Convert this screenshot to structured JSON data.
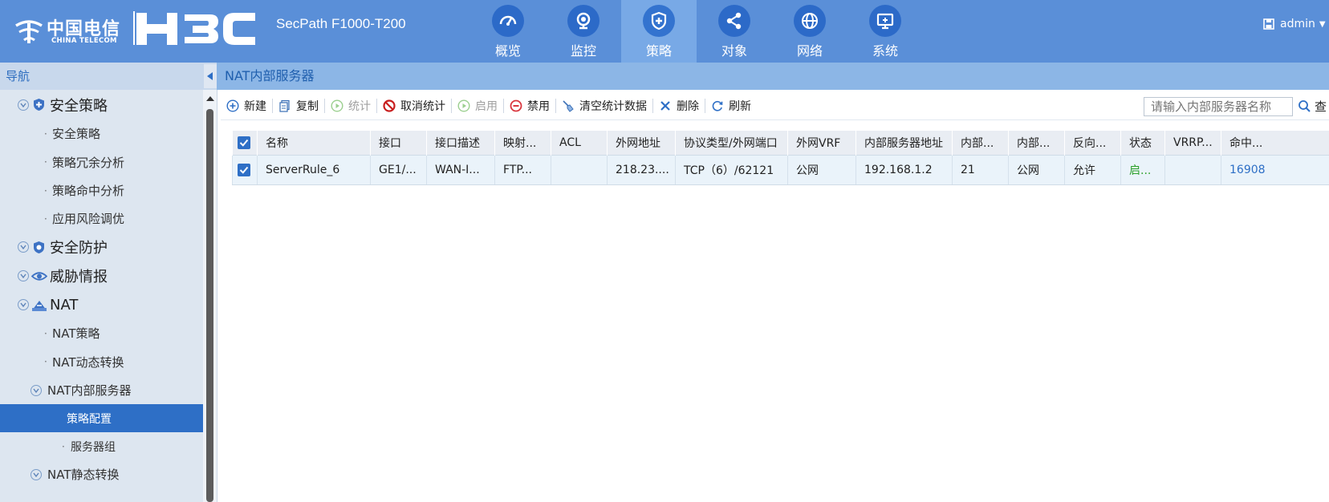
{
  "header": {
    "brand_cn": "中国电信",
    "brand_en": "CHINA TELECOM",
    "h3c_logo": "H3C",
    "product": "SecPath F1000-T200",
    "user": "admin",
    "nav": [
      {
        "label": "概览",
        "icon": "dashboard-icon"
      },
      {
        "label": "监控",
        "icon": "camera-icon"
      },
      {
        "label": "策略",
        "icon": "shield-icon",
        "active": true
      },
      {
        "label": "对象",
        "icon": "share-icon"
      },
      {
        "label": "网络",
        "icon": "globe-icon"
      },
      {
        "label": "系统",
        "icon": "monitor-icon"
      }
    ]
  },
  "sidebar": {
    "title": "导航",
    "items": [
      {
        "label": "安全策略"
      },
      {
        "label": "安全策略"
      },
      {
        "label": "策略冗余分析"
      },
      {
        "label": "策略命中分析"
      },
      {
        "label": "应用风险调优"
      },
      {
        "label": "安全防护"
      },
      {
        "label": "威胁情报"
      },
      {
        "label": "NAT"
      },
      {
        "label": "NAT策略"
      },
      {
        "label": "NAT动态转换"
      },
      {
        "label": "NAT内部服务器"
      },
      {
        "label": "策略配置",
        "selected": true
      },
      {
        "label": "服务器组"
      },
      {
        "label": "NAT静态转换"
      }
    ]
  },
  "main": {
    "title": "NAT内部服务器",
    "toolbar": {
      "new": "新建",
      "copy": "复制",
      "stats": "统计",
      "cancel_stats": "取消统计",
      "enable": "启用",
      "disable": "禁用",
      "clear_stats": "清空统计数据",
      "delete": "删除",
      "refresh": "刷新"
    },
    "search": {
      "placeholder": "请输入内部服务器名称",
      "button": "查"
    },
    "table": {
      "columns": [
        "名称",
        "接口",
        "接口描述",
        "映射...",
        "ACL",
        "外网地址",
        "协议类型/外网端口",
        "外网VRF",
        "内部服务器地址",
        "内部...",
        "内部...",
        "反向...",
        "状态",
        "VRRP...",
        "命中..."
      ],
      "rows": [
        [
          "ServerRule_6",
          "GE1/...",
          "WAN-I...",
          "FTP...",
          "",
          "218.23....",
          "TCP（6）/62121",
          "公网",
          "192.168.1.2",
          "21",
          "公网",
          "允许",
          "启...",
          "",
          "16908"
        ]
      ]
    }
  },
  "colors": {
    "topbar": "#5a8fd8",
    "nav_active": "#78a9e6",
    "selected": "#2e6fc6",
    "status_enabled": "#2ca02c"
  }
}
